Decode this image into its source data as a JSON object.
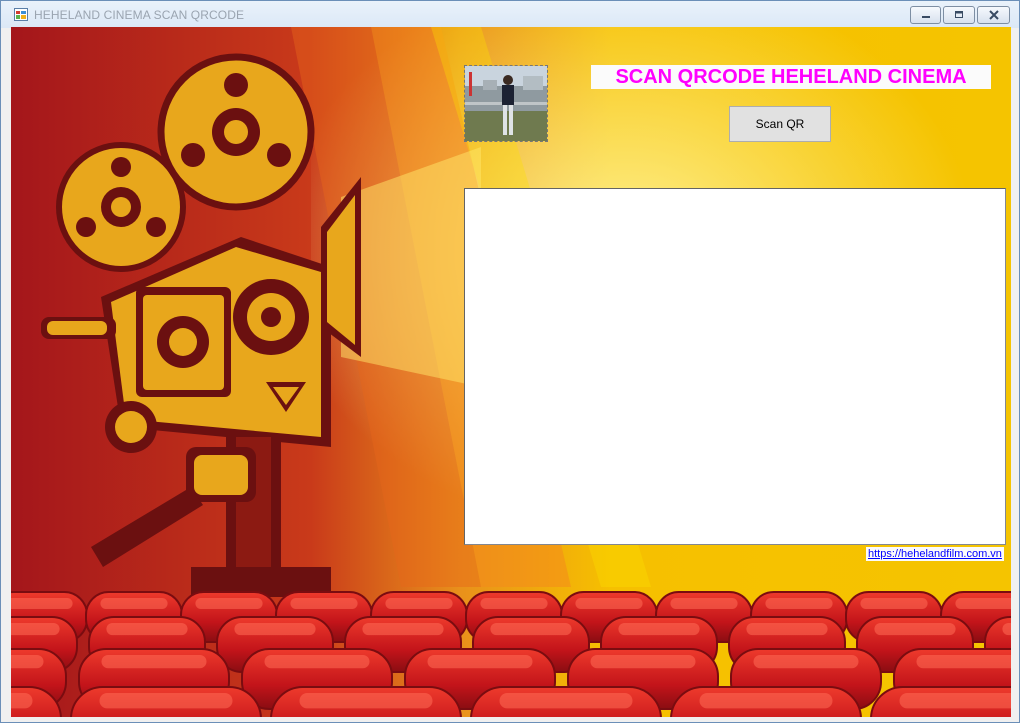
{
  "window": {
    "title": "HEHELAND CINEMA SCAN QRCODE",
    "controls": {
      "minimize": "minimize",
      "maximize": "maximize",
      "close": "close"
    }
  },
  "main": {
    "heading": "SCAN QRCODE HEHELAND CINEMA",
    "scan_button_label": "Scan QR",
    "website_link": "https://hehelandfilm.com.vn",
    "output_text": ""
  },
  "icons": {
    "app": "app-window-icon",
    "minimize": "minimize-icon",
    "maximize": "maximize-icon",
    "close": "close-icon"
  },
  "colors": {
    "heading_text": "#ff00ff",
    "link_text": "#0000ff",
    "background_red": "#b51c1c",
    "background_yellow": "#f5c000",
    "seat_red": "#d41717",
    "camera_gold": "#e8a71c",
    "camera_dark": "#6b1010"
  }
}
